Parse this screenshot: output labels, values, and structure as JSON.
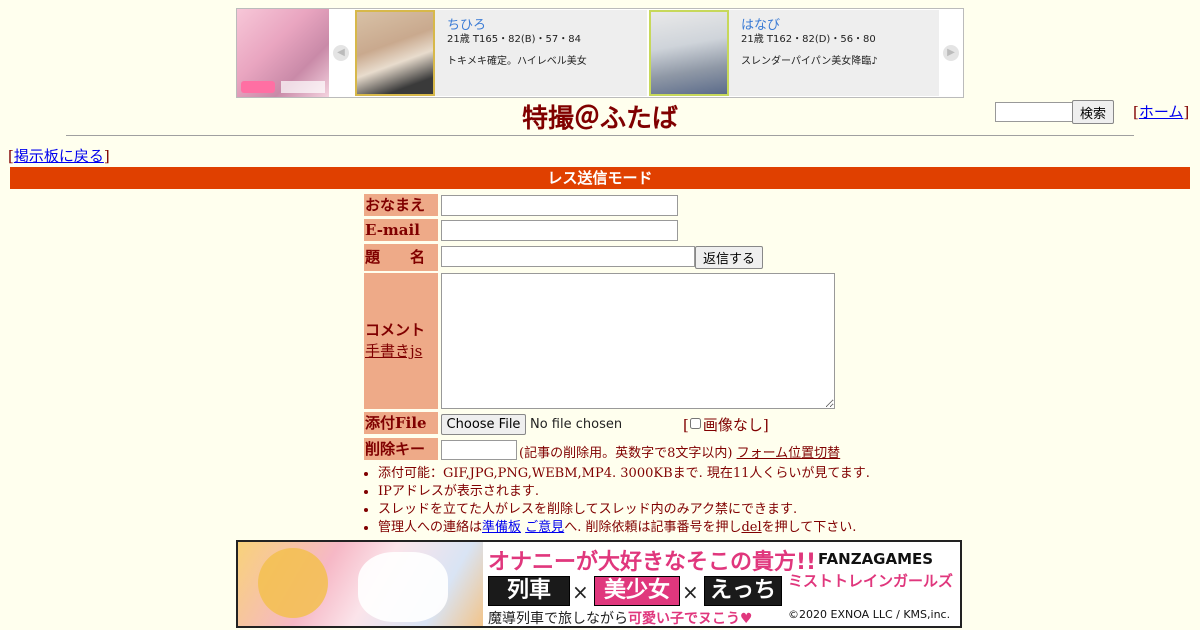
{
  "top_ad": {
    "cards": [
      {
        "name": "ちひろ",
        "stats": "21歳 T165・82(B)・57・84",
        "desc": "トキメキ確定。ハイレベル美女"
      },
      {
        "name": "はなび",
        "stats": "21歳 T162・82(D)・56・80",
        "desc": "スレンダーパイパン美女降臨♪"
      }
    ],
    "prev_arrow": "◀",
    "next_arrow": "▶"
  },
  "header": {
    "title": "特撮＠ふたば",
    "search_button": "検索",
    "home_link": "ホーム",
    "back_link": "掲示板に戻る"
  },
  "mode_bar": "レス送信モード",
  "form": {
    "name_label": "おなまえ",
    "email_label": "E-mail",
    "subject_label": "題　　名",
    "reply_button": "返信する",
    "comment_label": "コメント",
    "handwriting_link": "手書きjs",
    "file_label": "添付File",
    "choose_file_button": "Choose File",
    "no_file_text": "No file chosen",
    "no_image_label": "画像なし",
    "delete_key_label": "削除キー",
    "delete_note": "(記事の削除用。英数字で8文字以内)",
    "form_position_link": "フォーム位置切替"
  },
  "notes": {
    "line1": "添付可能：GIF,JPG,PNG,WEBM,MP4. 3000KBまで. 現在11人くらいが見てます.",
    "line2": "IPアドレスが表示されます.",
    "line3": "スレッドを立てた人がレスを削除してスレッド内のみアク禁にできます.",
    "line4_prefix": "管理人への連絡は",
    "line4_link1": "準備板",
    "line4_link2": "ご意見",
    "line4_mid": "へ. 削除依頼は記事番号を押し",
    "line4_link3": "del",
    "line4_suffix": "を押して下さい."
  },
  "bottom_ad": {
    "catchphrase": "オナニーが大好きなそこの貴方!!",
    "tag1": "列車",
    "tag2": "美少女",
    "tag3": "えっち",
    "times": "×",
    "bottom_prefix": "魔導列車で旅しながら",
    "bottom_highlight": "可愛い子でヌこう♥",
    "brand": "FANZAGAMES",
    "game_logo": "ミストトレインガールズ",
    "copyright": "©2020 EXNOA LLC / KMS,inc."
  }
}
